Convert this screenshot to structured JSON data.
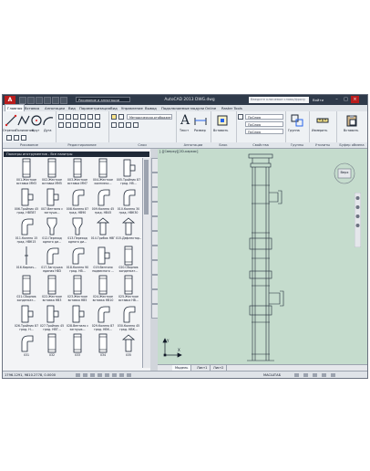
{
  "titlebar": {
    "logo": "A",
    "workspace": "Рисование и аннотации",
    "title": "AutoCAD 2013   DWG.dwg",
    "search_placeholder": "Введите ключевое слово/фразу",
    "signin": "Войти"
  },
  "tabs": [
    {
      "label": "Главная",
      "active": true
    },
    {
      "label": "Вставка"
    },
    {
      "label": "Аннотации"
    },
    {
      "label": "Вид"
    },
    {
      "label": "Параметризация"
    },
    {
      "label": "Вид"
    },
    {
      "label": "Управление"
    },
    {
      "label": "Вывод"
    },
    {
      "label": "Подключаемые модули"
    },
    {
      "label": "Online"
    },
    {
      "label": "Raster Tools"
    }
  ],
  "ribbon": {
    "panels": [
      {
        "title": "Рисование",
        "big": [
          "Отрезок",
          "Полилиния",
          "Круг",
          "Дуга"
        ]
      },
      {
        "title": "Редактирование"
      },
      {
        "title": "Слои",
        "layer_value": "Методическая,отображение,строительство"
      },
      {
        "title": "Аннотации",
        "big": [
          "Текст",
          "Размер"
        ]
      },
      {
        "title": "Блок",
        "big": [
          "Вставить"
        ]
      },
      {
        "title": "Свойства",
        "props": [
          "ПоСлою",
          "ПоСлою",
          "ПоСлою"
        ]
      },
      {
        "title": "Группы",
        "big": [
          "Группа"
        ]
      },
      {
        "title": "Утилиты",
        "big": [
          "Измерить"
        ]
      },
      {
        "title": "Буфер обмена",
        "big": [
          "Вставить"
        ]
      }
    ]
  },
  "palette": {
    "title": "Палитры инструментов - Все палитры",
    "items": [
      {
        "label": "001.Жесткое вставка ММ3",
        "icon": "pipe-icon"
      },
      {
        "label": "002.Жесткое вставка ММ5",
        "icon": "pipe-icon"
      },
      {
        "label": "003.Жесткое вставка ММ7",
        "icon": "pipe-icon"
      },
      {
        "label": "004.Жесткое комплекс...",
        "icon": "pipe-icon"
      },
      {
        "label": "005.Тройник 87 град. НВ...",
        "icon": "tee-icon"
      },
      {
        "label": "006.Тройник 45 град. НВП87",
        "icon": "tee-icon"
      },
      {
        "label": "007.Вентиля с заглушк...",
        "icon": "tee-icon"
      },
      {
        "label": "008.Колено 87 град. НВ90",
        "icon": "elbow-icon"
      },
      {
        "label": "009.Колено 45 град. НВ45",
        "icon": "elbow-icon"
      },
      {
        "label": "010.Колено 30 град. НВК30",
        "icon": "elbow-icon"
      },
      {
        "label": "011.Колено 15 град. НВК15",
        "icon": "elbow-icon"
      },
      {
        "label": "012.Переход одного ди...",
        "icon": "reducer-icon"
      },
      {
        "label": "013.Переход одного ди...",
        "icon": "reducer-icon"
      },
      {
        "label": "014.Грибок НВГ",
        "icon": "cap-icon"
      },
      {
        "label": "015.Дефлектор...",
        "icon": "cap-icon"
      },
      {
        "label": "016.Кирпич...",
        "icon": "line-icon"
      },
      {
        "label": "017.Заглушка единая НВЗ",
        "icon": "elbow-icon"
      },
      {
        "label": "018.Колено 90 град. НВ...",
        "icon": "elbow-icon"
      },
      {
        "label": "019.Вентиля подвесного ...",
        "icon": "tee-icon"
      },
      {
        "label": "020.Сборник конденсат...",
        "icon": "pipe-icon"
      },
      {
        "label": "021.Сборник конденсат...",
        "icon": "pipe-icon"
      },
      {
        "label": "022.Жесткое вставка НВ3",
        "icon": "pipe-icon"
      },
      {
        "label": "023.Жесткое вставка НВ5",
        "icon": "pipe-icon"
      },
      {
        "label": "024.Жесткое вставка НВ10",
        "icon": "pipe-icon"
      },
      {
        "label": "025.Жесткое вставка НВ...",
        "icon": "pipe-icon"
      },
      {
        "label": "026.Тройник 87 град. Н...",
        "icon": "tee-icon"
      },
      {
        "label": "027.Тройник 45 град. НВТ...",
        "icon": "tee-icon"
      },
      {
        "label": "028.Вентиля с заглушк...",
        "icon": "tee-icon"
      },
      {
        "label": "029.Колено 87 град. НВК...",
        "icon": "elbow-icon"
      },
      {
        "label": "030.Колено 45 град. НВК...",
        "icon": "elbow-icon"
      },
      {
        "label": "031",
        "icon": "elbow-icon"
      },
      {
        "label": "032",
        "icon": "pipe-icon"
      },
      {
        "label": "033",
        "icon": "pipe-icon"
      },
      {
        "label": "034",
        "icon": "pipe-icon"
      },
      {
        "label": "035",
        "icon": "cap-icon"
      }
    ]
  },
  "viewport": {
    "label": "[-][Сверху][2D-каркас]",
    "viewcube_face": "Верх"
  },
  "layout_tabs": [
    {
      "label": "Модель",
      "active": true
    },
    {
      "label": "Лист1"
    },
    {
      "label": "Лист2"
    }
  ],
  "status": {
    "coords": "1796.1291, 9810.2778, 0.0000",
    "scale": "МАСШТАБ"
  },
  "colors": {
    "canvas": "#c5dccd",
    "titlebar": "#2f3a4a",
    "accent": "#b91c1c"
  }
}
